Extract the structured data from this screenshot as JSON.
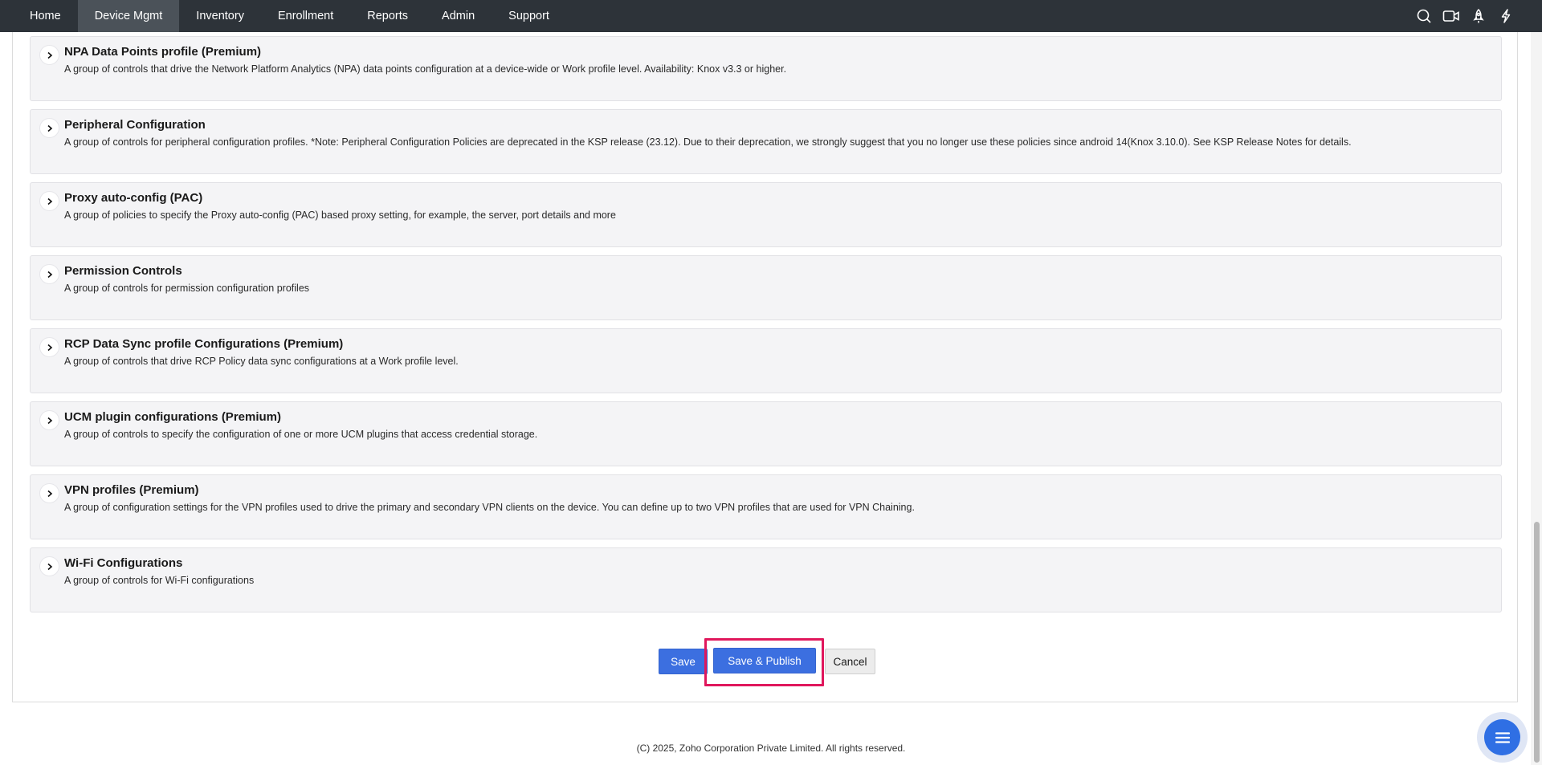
{
  "nav": {
    "items": [
      {
        "label": "Home",
        "active": false
      },
      {
        "label": "Device Mgmt",
        "active": true
      },
      {
        "label": "Inventory",
        "active": false
      },
      {
        "label": "Enrollment",
        "active": false
      },
      {
        "label": "Reports",
        "active": false
      },
      {
        "label": "Admin",
        "active": false
      },
      {
        "label": "Support",
        "active": false
      }
    ],
    "icons": [
      "search-icon",
      "video-icon",
      "rocket-icon",
      "lightning-icon"
    ]
  },
  "accordion": [
    {
      "title": "NPA Data Points profile (Premium)",
      "description": "A group of controls that drive the Network Platform Analytics (NPA) data points configuration at a device-wide or Work profile level. Availability: Knox v3.3 or higher."
    },
    {
      "title": "Peripheral Configuration",
      "description": "A group of controls for peripheral configuration profiles. *Note: Peripheral Configuration Policies are deprecated in the KSP release (23.12). Due to their deprecation, we strongly suggest that you no longer use these policies since android 14(Knox 3.10.0). See KSP Release Notes for details."
    },
    {
      "title": "Proxy auto-config (PAC)",
      "description": "A group of policies to specify the Proxy auto-config (PAC) based proxy setting, for example, the server, port details and more"
    },
    {
      "title": "Permission Controls",
      "description": "A group of controls for permission configuration profiles"
    },
    {
      "title": "RCP Data Sync profile Configurations (Premium)",
      "description": "A group of controls that drive RCP Policy data sync configurations at a Work profile level."
    },
    {
      "title": "UCM plugin configurations (Premium)",
      "description": "A group of controls to specify the configuration of one or more UCM plugins that access credential storage."
    },
    {
      "title": "VPN profiles (Premium)",
      "description": "A group of configuration settings for the VPN profiles used to drive the primary and secondary VPN clients on the device. You can define up to two VPN profiles that are used for VPN Chaining."
    },
    {
      "title": "Wi-Fi Configurations",
      "description": "A group of controls for Wi-Fi configurations"
    }
  ],
  "actions": {
    "save_label": "Save",
    "publish_label": "Save & Publish",
    "cancel_label": "Cancel"
  },
  "footer": {
    "text": "(C) 2025, Zoho Corporation Private Limited. All rights reserved."
  },
  "colors": {
    "nav_bg": "#2d3339",
    "primary": "#3c6fe0",
    "highlight": "#e0175c"
  }
}
